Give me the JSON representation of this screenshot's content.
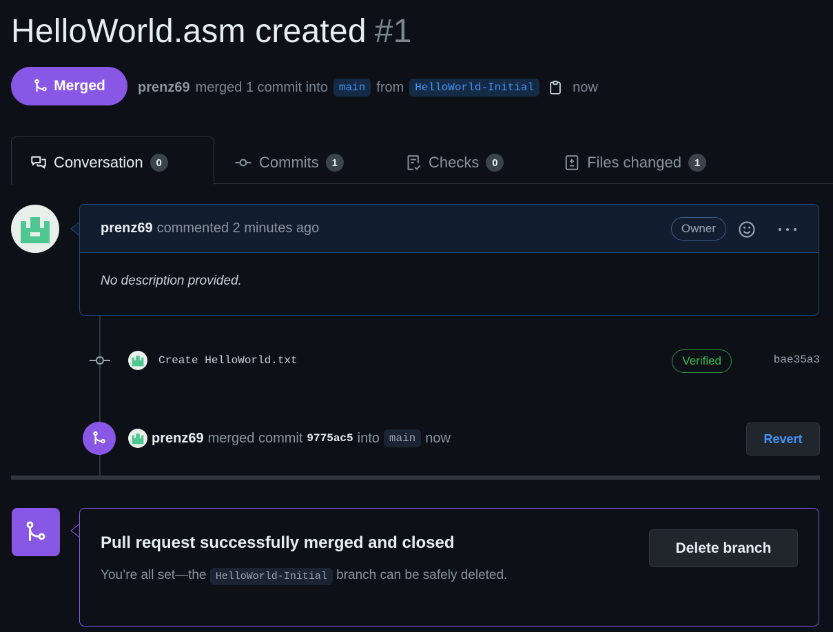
{
  "pr": {
    "title": "HelloWorld.asm created",
    "number": "#1",
    "state_label": "Merged",
    "author": "prenz69",
    "merged_text": "merged 1 commit into",
    "base_branch": "main",
    "from_text": "from",
    "head_branch": "HelloWorld-Initial",
    "time": "now"
  },
  "tabs": [
    {
      "label": "Conversation",
      "count": "0",
      "icon": "conversation-icon"
    },
    {
      "label": "Commits",
      "count": "1",
      "icon": "commit-icon"
    },
    {
      "label": "Checks",
      "count": "0",
      "icon": "checklist-icon"
    },
    {
      "label": "Files changed",
      "count": "1",
      "icon": "file-diff-icon"
    }
  ],
  "comment": {
    "author": "prenz69",
    "meta": "commented 2 minutes ago",
    "role_badge": "Owner",
    "body": "No description provided."
  },
  "commit": {
    "message": "Create HelloWorld.txt",
    "verified_label": "Verified",
    "sha": "bae35a3"
  },
  "merge_event": {
    "author": "prenz69",
    "text1": "merged commit",
    "sha": "9775ac5",
    "text2": "into",
    "branch": "main",
    "time": "now",
    "revert_label": "Revert"
  },
  "merge_box": {
    "heading": "Pull request successfully merged and closed",
    "desc_before": "You’re all set—the",
    "branch": "HelloWorld-Initial",
    "desc_after": "branch can be safely deleted.",
    "delete_label": "Delete branch"
  },
  "colors": {
    "background": "#0d1117",
    "merged_purple": "#8957e5",
    "link_blue": "#4493f8",
    "verified_green": "#3fb950"
  }
}
